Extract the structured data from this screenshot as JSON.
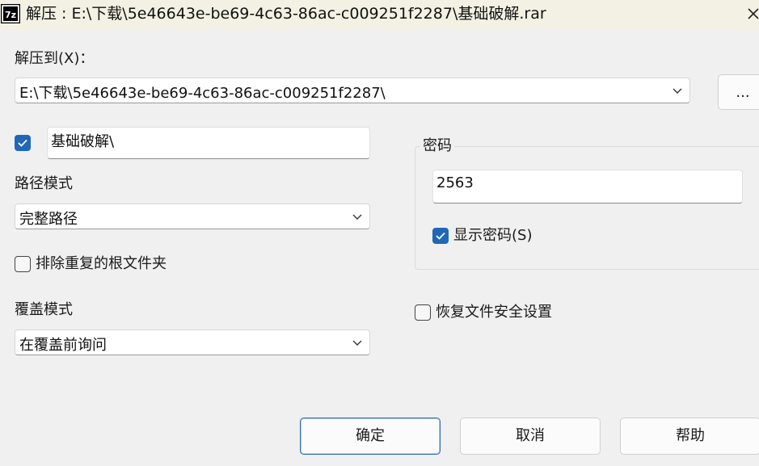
{
  "title": {
    "app_icon_text": "7z",
    "text": "解压 : E:\\下载\\5e46643e-be69-4c63-86ac-c009251f2287\\基础破解.rar"
  },
  "extract_to": {
    "label": "解压到(X)：",
    "path": "E:\\下载\\5e46643e-be69-4c63-86ac-c009251f2287\\",
    "browse_label": "..."
  },
  "subfolder": {
    "checked": true,
    "value": "基础破解\\"
  },
  "path_mode": {
    "label": "路径模式",
    "value": "完整路径"
  },
  "exclude_root": {
    "checked": false,
    "label": "排除重复的根文件夹"
  },
  "overwrite_mode": {
    "label": "覆盖模式",
    "value": "在覆盖前询问"
  },
  "password": {
    "group_label": "密码",
    "value": "2563",
    "show_label": "显示密码(S)",
    "show_checked": true
  },
  "restore_security": {
    "checked": false,
    "label": "恢复文件安全设置"
  },
  "buttons": {
    "ok": "确定",
    "cancel": "取消",
    "help": "帮助"
  },
  "colors": {
    "checkbox_accent": "#1f67b8",
    "title_bar": "#f2f1e3",
    "dialog_bg": "#f0f0f0"
  }
}
